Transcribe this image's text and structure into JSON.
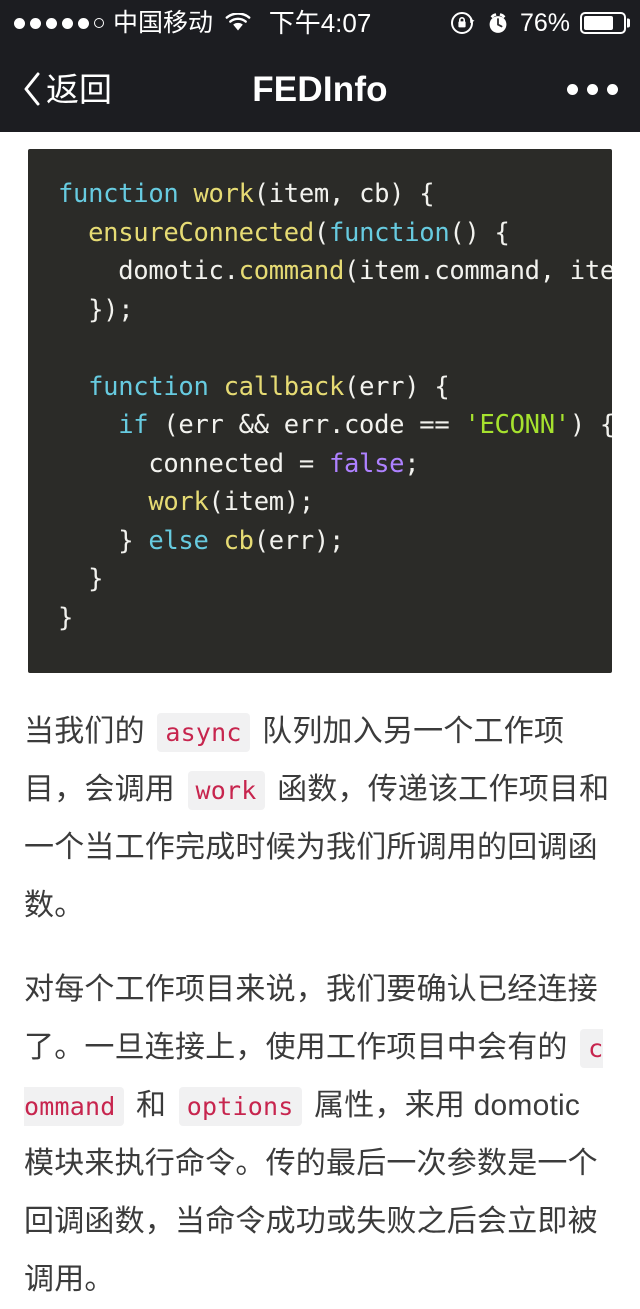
{
  "status_bar": {
    "signal_dots_filled": 5,
    "signal_dots_total": 6,
    "carrier": "中国移动",
    "wifi_icon": "wifi-icon",
    "time": "下午4:07",
    "rotation_lock_icon": "rotation-lock-icon",
    "alarm_icon": "alarm-clock-icon",
    "battery_percent": "76%",
    "battery_level": 76,
    "background_color": "#1c1d21",
    "foreground_color": "#ffffff"
  },
  "nav_bar": {
    "back_icon": "chevron-left-icon",
    "back_label": "返回",
    "title": "FEDInfo",
    "more_icon": "ellipsis-icon",
    "background_color": "#1c1d21"
  },
  "code_block": {
    "background_color": "#2b2b28",
    "language": "javascript",
    "theme_colors": {
      "keyword": "#67cbe0",
      "function_name": "#e6db74",
      "string": "#a6e22e",
      "literal": "#ae81ff",
      "plain": "#f2f2ee"
    },
    "lines": [
      [
        {
          "t": "function",
          "c": "kw"
        },
        {
          "t": " ",
          "c": "pln"
        },
        {
          "t": "work",
          "c": "fn"
        },
        {
          "t": "(item, cb) {",
          "c": "pln"
        }
      ],
      [
        {
          "t": "  ",
          "c": "pln"
        },
        {
          "t": "ensureConnected",
          "c": "fn"
        },
        {
          "t": "(",
          "c": "pln"
        },
        {
          "t": "function",
          "c": "kw"
        },
        {
          "t": "() {",
          "c": "pln"
        }
      ],
      [
        {
          "t": "    domotic.",
          "c": "pln"
        },
        {
          "t": "command",
          "c": "fn"
        },
        {
          "t": "(item.command, item",
          "c": "pln"
        }
      ],
      [
        {
          "t": "  });",
          "c": "pln"
        }
      ],
      [
        {
          "t": "",
          "c": "pln"
        }
      ],
      [
        {
          "t": "  ",
          "c": "pln"
        },
        {
          "t": "function",
          "c": "kw"
        },
        {
          "t": " ",
          "c": "pln"
        },
        {
          "t": "callback",
          "c": "fn"
        },
        {
          "t": "(err) {",
          "c": "pln"
        }
      ],
      [
        {
          "t": "    ",
          "c": "pln"
        },
        {
          "t": "if",
          "c": "kw"
        },
        {
          "t": " (err && err.code == ",
          "c": "pln"
        },
        {
          "t": "'ECONN'",
          "c": "str"
        },
        {
          "t": ") {",
          "c": "pln"
        }
      ],
      [
        {
          "t": "      connected = ",
          "c": "pln"
        },
        {
          "t": "false",
          "c": "lit"
        },
        {
          "t": ";",
          "c": "pln"
        }
      ],
      [
        {
          "t": "      ",
          "c": "pln"
        },
        {
          "t": "work",
          "c": "fn"
        },
        {
          "t": "(item);",
          "c": "pln"
        }
      ],
      [
        {
          "t": "    } ",
          "c": "pln"
        },
        {
          "t": "else",
          "c": "kw"
        },
        {
          "t": " ",
          "c": "pln"
        },
        {
          "t": "cb",
          "c": "fn"
        },
        {
          "t": "(err);",
          "c": "pln"
        }
      ],
      [
        {
          "t": "  }",
          "c": "pln"
        }
      ],
      [
        {
          "t": "}",
          "c": "pln"
        }
      ]
    ]
  },
  "body": {
    "text_color": "#3b3b3b",
    "inline_code_color": "#c7254e",
    "inline_code_bg": "#f1f1f2",
    "paragraphs": [
      {
        "id": "paragraph-1",
        "runs": [
          {
            "type": "text",
            "t": "当我们的 "
          },
          {
            "type": "code",
            "t": "async"
          },
          {
            "type": "text",
            "t": " 队列加入另一个工作项目，会调用 "
          },
          {
            "type": "code",
            "t": "work"
          },
          {
            "type": "text",
            "t": " 函数，传递该工作项目和一个当工作完成时候为我们所调用的回调函数。"
          }
        ]
      },
      {
        "id": "paragraph-2",
        "runs": [
          {
            "type": "text",
            "t": "对每个工作项目来说，我们要确认已经连接了。一旦连接上，使用工作项目中会有的 "
          },
          {
            "type": "code",
            "t": "command"
          },
          {
            "type": "text",
            "t": " 和 "
          },
          {
            "type": "code",
            "t": "options"
          },
          {
            "type": "text",
            "t": " 属性，来用 domotic 模块来执行命令。传的最后一次参数是一个回调函数，当命令成功或失败之后会立即被调用。"
          }
        ]
      }
    ]
  }
}
